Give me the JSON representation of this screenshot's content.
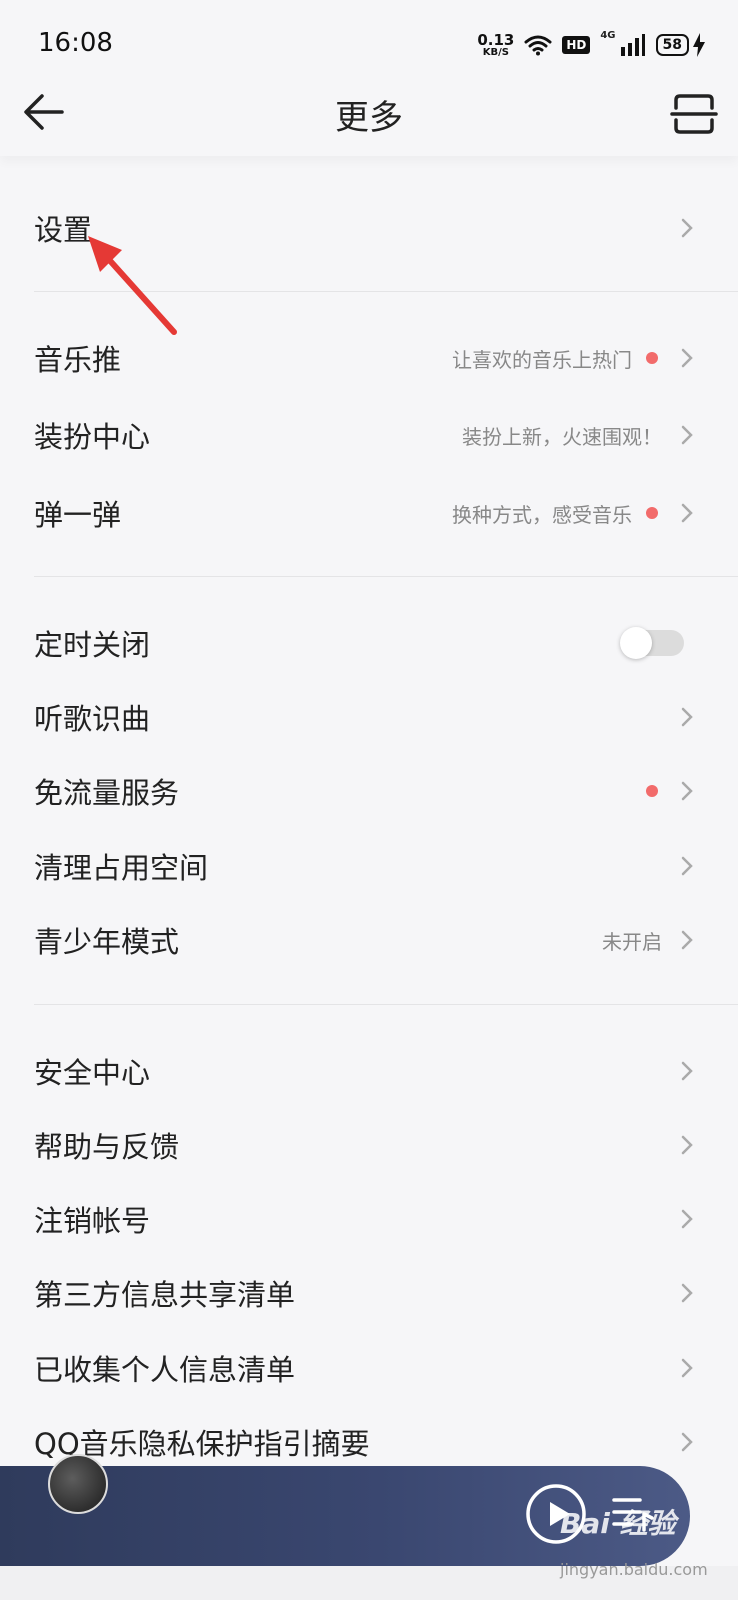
{
  "status_bar": {
    "time": "16:08",
    "net_speed_value": "0.13",
    "net_speed_unit": "KB/S",
    "hd_label": "HD",
    "network_label": "4G",
    "battery": "58"
  },
  "header": {
    "title": "更多",
    "back_icon": "arrow-left-icon",
    "scan_icon": "scan-icon"
  },
  "sections": {
    "group1": [
      {
        "label": "设置"
      }
    ],
    "group2": [
      {
        "label": "音乐推",
        "sub": "让喜欢的音乐上热门",
        "dot": true
      },
      {
        "label": "装扮中心",
        "sub": "装扮上新，火速围观！",
        "dot": false
      },
      {
        "label": "弹一弹",
        "sub": "换种方式，感受音乐",
        "dot": true
      }
    ],
    "group3": [
      {
        "label": "定时关闭",
        "toggle": false
      },
      {
        "label": "听歌识曲"
      },
      {
        "label": "免流量服务",
        "dot": true
      },
      {
        "label": "清理占用空间"
      },
      {
        "label": "青少年模式",
        "sub": "未开启"
      }
    ],
    "group4": [
      {
        "label": "安全中心"
      },
      {
        "label": "帮助与反馈"
      },
      {
        "label": "注销帐号"
      },
      {
        "label": "第三方信息共享清单"
      },
      {
        "label": "已收集个人信息清单"
      },
      {
        "label": "QQ音乐隐私保护指引摘要"
      }
    ]
  },
  "watermark": {
    "text": "Bai 经验",
    "url": "jingyan.baidu.com"
  },
  "colors": {
    "red_dot": "#f26b6b",
    "annotation_arrow": "#e53935",
    "player_bar": "#3a4770"
  }
}
